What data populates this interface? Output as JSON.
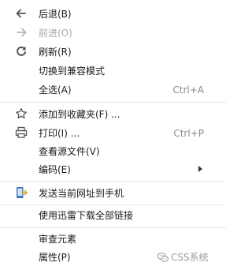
{
  "menu": {
    "back": {
      "label": "后退(B)",
      "icon": "arrow-left-icon"
    },
    "forward": {
      "label": "前进(O)",
      "icon": "arrow-right-icon",
      "disabled": true
    },
    "refresh": {
      "label": "刷新(R)",
      "icon": "refresh-icon"
    },
    "compat_mode": {
      "label": "切换到兼容模式"
    },
    "select_all": {
      "label": "全选(A)",
      "shortcut": "Ctrl+A"
    },
    "add_favorite": {
      "label": "添加到收藏夹(F) ...",
      "icon": "star-icon"
    },
    "print": {
      "label": "打印(I) ...",
      "shortcut": "Ctrl+P",
      "icon": "printer-icon"
    },
    "view_source": {
      "label": "查看源文件(V)"
    },
    "encoding": {
      "label": "编码(E)",
      "has_submenu": true
    },
    "send_to_phone": {
      "label": "发送当前网址到手机",
      "icon": "phone-icon"
    },
    "xunlei_download": {
      "label": "使用迅雷下载全部链接"
    },
    "inspect": {
      "label": "审查元素"
    },
    "properties": {
      "label": "属性(P)"
    }
  },
  "watermark": {
    "text": "CSS系统",
    "icon": "wechat-icon"
  },
  "colors": {
    "icon": "#555555",
    "disabled": "#a8a8a8",
    "separator": "#e6e6e6",
    "phone_icon": "#3d6fb6"
  }
}
